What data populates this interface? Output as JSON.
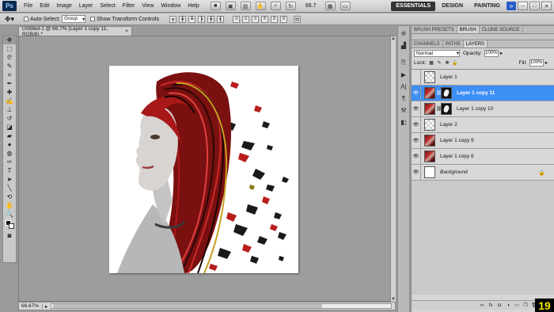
{
  "app": {
    "logo": "Ps"
  },
  "menubar": {
    "items": [
      "File",
      "Edit",
      "Image",
      "Layer",
      "Select",
      "Filter",
      "View",
      "Window",
      "Help"
    ],
    "zoom": "66.7",
    "workspaces": {
      "essentials": "ESSENTIALS",
      "design": "DESIGN",
      "painting": "PAINTING",
      "more": "»"
    },
    "window_controls": {
      "minimize": "–",
      "restore": "□",
      "close": "✕"
    }
  },
  "options": {
    "auto_select_label": "Auto-Select:",
    "auto_select_value": "Group",
    "show_transform_label": "Show Transform Controls"
  },
  "document": {
    "tab_title": "Untitled-1 @ 66.7% (Layer 1 copy 11, RGB/8) *",
    "close": "×",
    "zoom_status": "66.67%"
  },
  "panel": {
    "top_tabs": [
      "BRUSH PRESETS",
      "BRUSH",
      "CLONE SOURCE"
    ],
    "tabs": [
      "CHANNELS",
      "PATHS",
      "LAYERS"
    ],
    "blend_mode": "Normal",
    "opacity_label": "Opacity:",
    "opacity": "100%",
    "lock_label": "Lock:",
    "fill_label": "Fill:",
    "fill": "100%"
  },
  "layers": [
    {
      "name": "Layer 1",
      "visible": false,
      "thumb": "check",
      "mask": false,
      "selected": false
    },
    {
      "name": "Layer 1 copy 11",
      "visible": true,
      "thumb": "photo",
      "mask": true,
      "selected": true
    },
    {
      "name": "Layer 1 copy 10",
      "visible": true,
      "thumb": "photo",
      "mask": true,
      "selected": false
    },
    {
      "name": "Layer 2",
      "visible": true,
      "thumb": "check",
      "mask": false,
      "selected": false
    },
    {
      "name": "Layer 1 copy 9",
      "visible": true,
      "thumb": "photo",
      "mask": false,
      "selected": false
    },
    {
      "name": "Layer 1 copy 8",
      "visible": true,
      "thumb": "photo",
      "mask": false,
      "selected": false
    },
    {
      "name": "Background",
      "visible": true,
      "thumb": "white",
      "mask": false,
      "selected": false,
      "locked": true
    }
  ],
  "badge": "19",
  "colors": {
    "selection": "#3d8ef5",
    "workspace_bg": "#9d9d9d",
    "hair_red": "#c02020"
  }
}
